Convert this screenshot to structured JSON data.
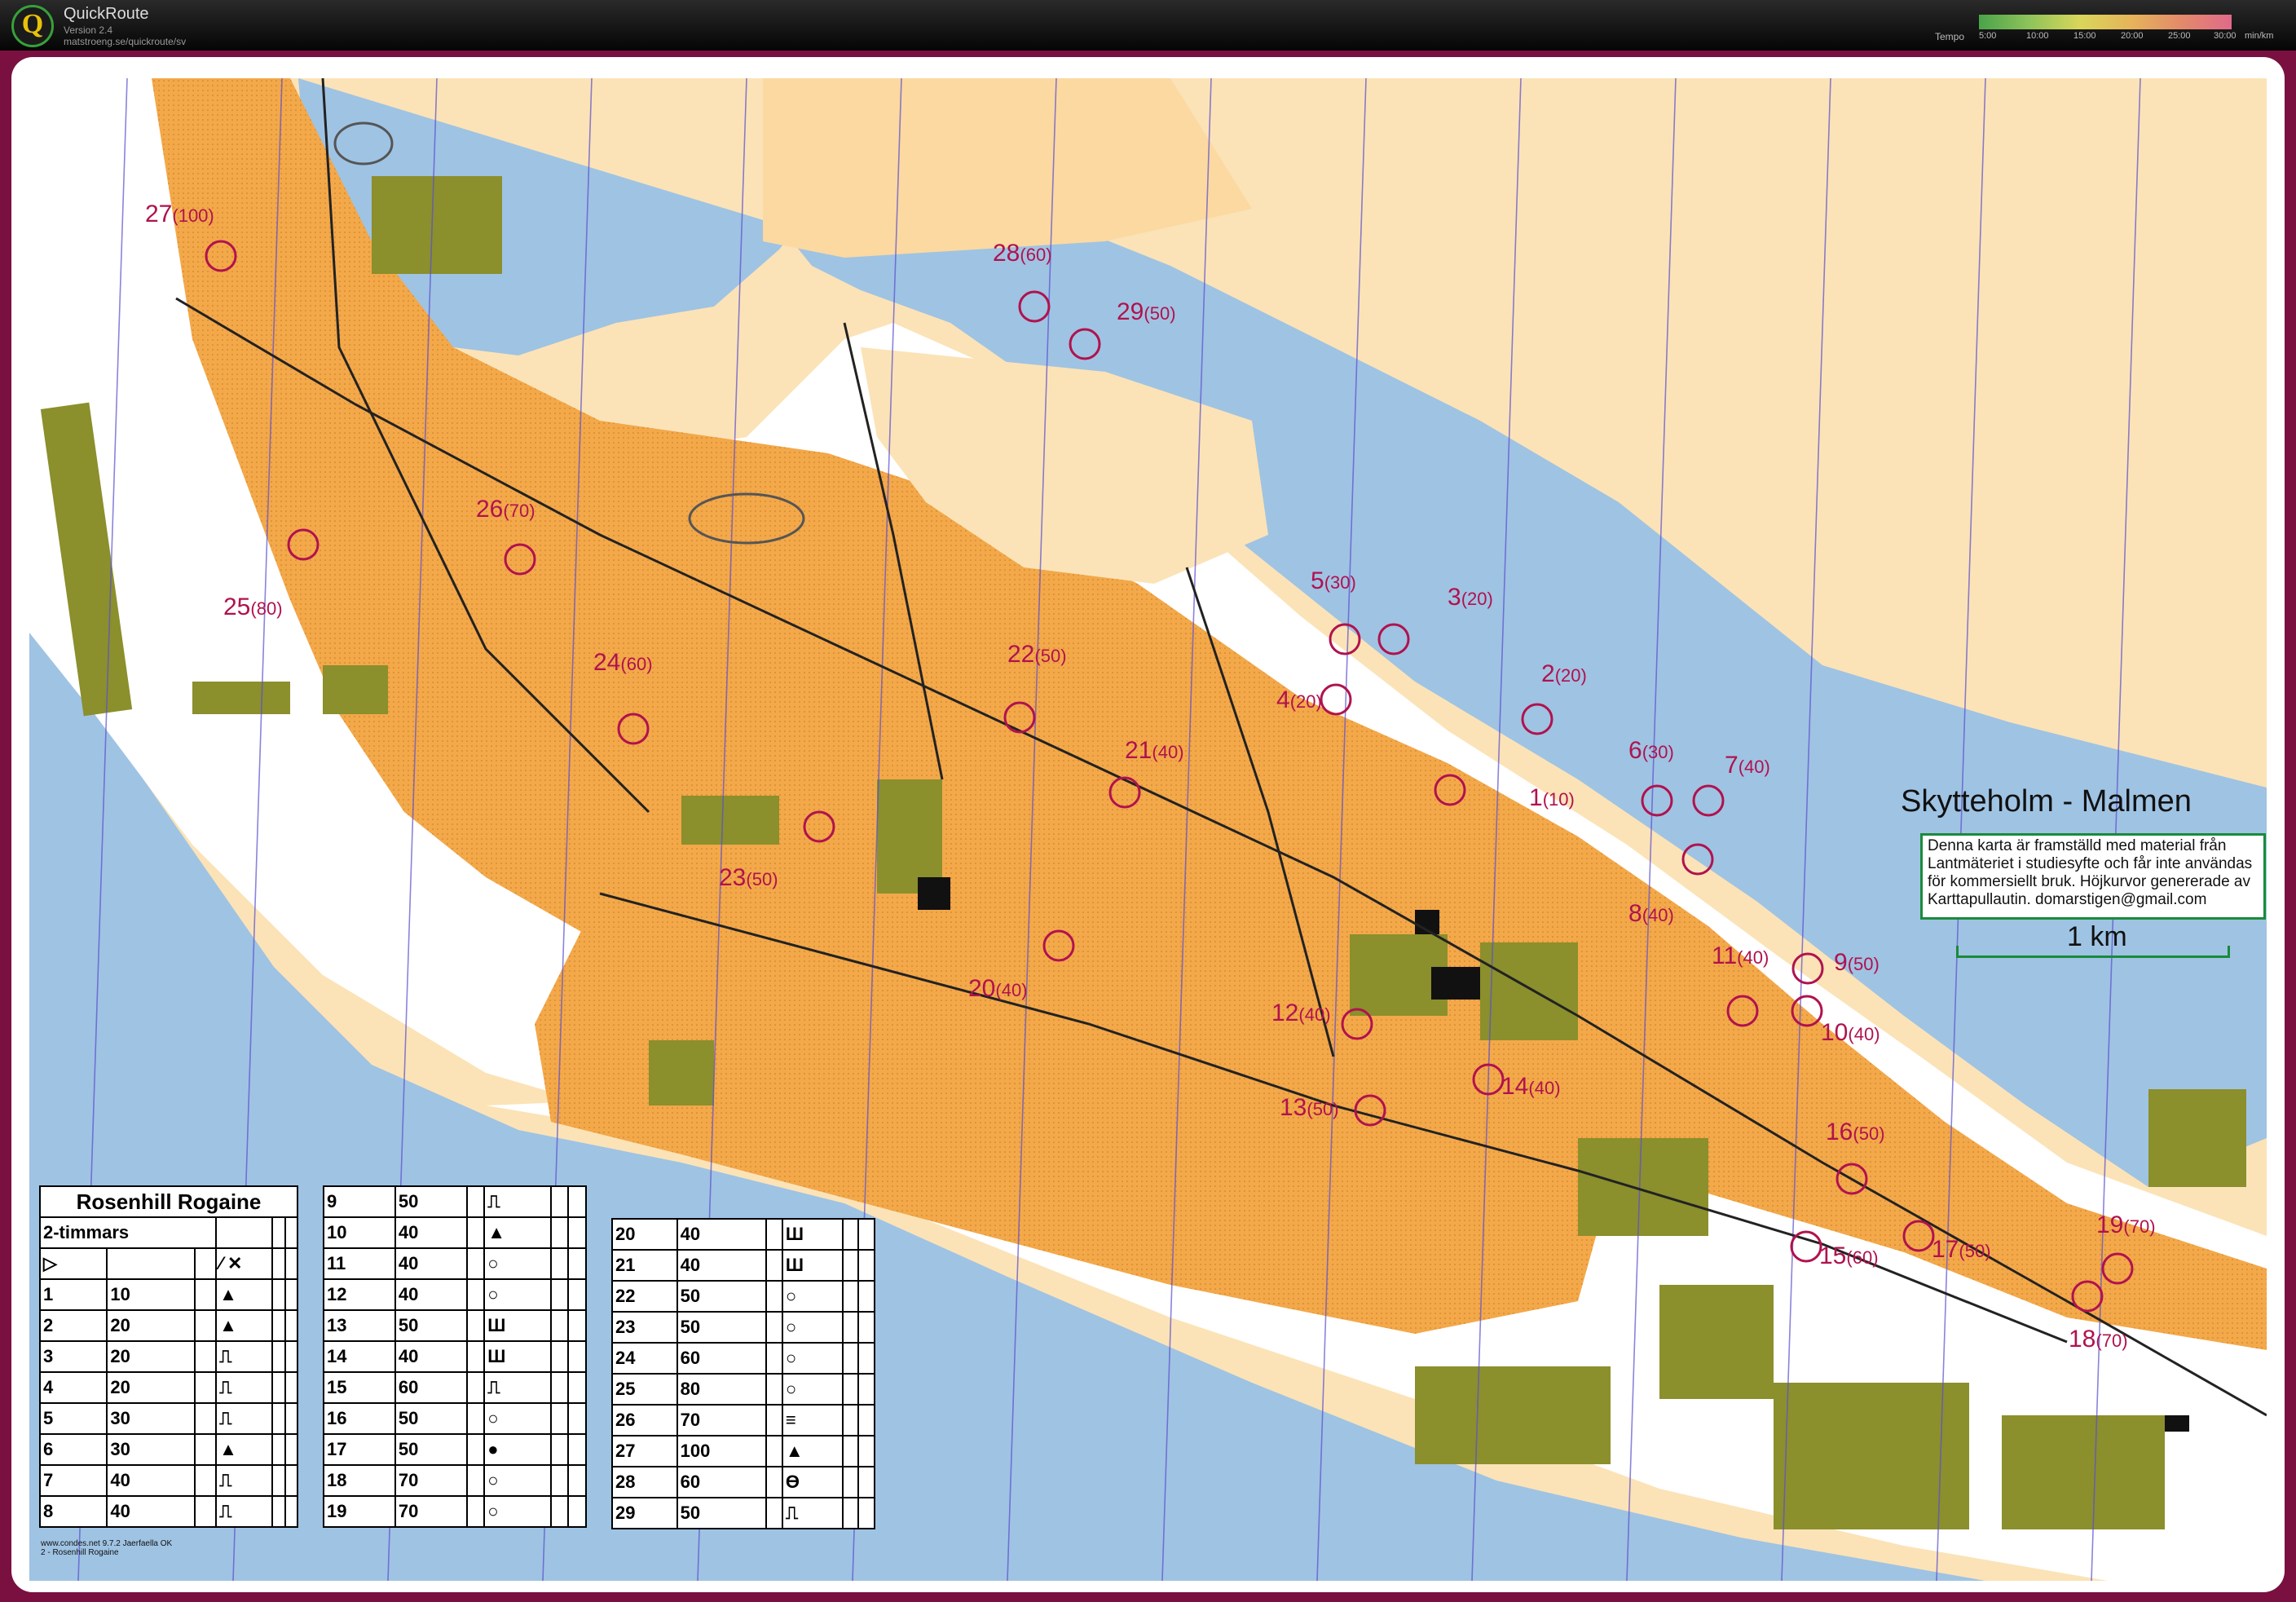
{
  "app": {
    "name": "QuickRoute",
    "version": "Version 2.4",
    "url": "matstroeng.se/quickroute/sv"
  },
  "tempo": {
    "label": "Tempo",
    "ticks": [
      "5:00",
      "10:00",
      "15:00",
      "20:00",
      "25:00",
      "30:00"
    ],
    "unit": "min/km"
  },
  "map": {
    "title": "Skytteholm - Malmen",
    "notice": "Denna karta är framställd med material från Lantmäteriet i studiesyfte och får inte användas för kommersiellt bruk. Höjkurvor genererade av Karttapullautin. domarstigen@gmail.com",
    "scale_label": "1 km",
    "footer_lines": [
      "www.condes.net 9.7.2 Jaerfaella OK",
      "2 - Rosenhill Rogaine"
    ],
    "colors": {
      "water": "#9fc3e3",
      "open": "#f3a84a",
      "rough_open": "#fbd9a1",
      "building": "#8b8f2c",
      "control": "#b0124e",
      "frame": "#7a1040"
    },
    "controls": [
      {
        "n": "1",
        "pts": "10"
      },
      {
        "n": "2",
        "pts": "20"
      },
      {
        "n": "3",
        "pts": "20"
      },
      {
        "n": "4",
        "pts": "20"
      },
      {
        "n": "5",
        "pts": "30"
      },
      {
        "n": "6",
        "pts": "30"
      },
      {
        "n": "7",
        "pts": "40"
      },
      {
        "n": "8",
        "pts": "40"
      },
      {
        "n": "9",
        "pts": "50"
      },
      {
        "n": "10",
        "pts": "40"
      },
      {
        "n": "11",
        "pts": "40"
      },
      {
        "n": "12",
        "pts": "40"
      },
      {
        "n": "13",
        "pts": "50"
      },
      {
        "n": "14",
        "pts": "40"
      },
      {
        "n": "15",
        "pts": "60"
      },
      {
        "n": "16",
        "pts": "50"
      },
      {
        "n": "17",
        "pts": "50"
      },
      {
        "n": "18",
        "pts": "70"
      },
      {
        "n": "19",
        "pts": "70"
      },
      {
        "n": "20",
        "pts": "40"
      },
      {
        "n": "21",
        "pts": "40"
      },
      {
        "n": "22",
        "pts": "50"
      },
      {
        "n": "23",
        "pts": "50"
      },
      {
        "n": "24",
        "pts": "60"
      },
      {
        "n": "25",
        "pts": "80"
      },
      {
        "n": "26",
        "pts": "70"
      },
      {
        "n": "27",
        "pts": "100"
      },
      {
        "n": "28",
        "pts": "60"
      },
      {
        "n": "29",
        "pts": "50"
      }
    ]
  },
  "description_sheet": {
    "title": "Rosenhill Rogaine",
    "subtitle": "2-timmars",
    "col1": [
      {
        "n": "1",
        "p": "10",
        "sym": "▲"
      },
      {
        "n": "2",
        "p": "20",
        "sym": "▲"
      },
      {
        "n": "3",
        "p": "20",
        "sym": "⎍"
      },
      {
        "n": "4",
        "p": "20",
        "sym": "⎍"
      },
      {
        "n": "5",
        "p": "30",
        "sym": "⎍"
      },
      {
        "n": "6",
        "p": "30",
        "sym": "▲"
      },
      {
        "n": "7",
        "p": "40",
        "sym": "⎍"
      },
      {
        "n": "8",
        "p": "40",
        "sym": "⎍"
      }
    ],
    "col2": [
      {
        "n": "9",
        "p": "50",
        "sym": "⎍"
      },
      {
        "n": "10",
        "p": "40",
        "sym": "▲"
      },
      {
        "n": "11",
        "p": "40",
        "sym": "○"
      },
      {
        "n": "12",
        "p": "40",
        "sym": "○"
      },
      {
        "n": "13",
        "p": "50",
        "sym": "Ш"
      },
      {
        "n": "14",
        "p": "40",
        "sym": "Ш"
      },
      {
        "n": "15",
        "p": "60",
        "sym": "⎍"
      },
      {
        "n": "16",
        "p": "50",
        "sym": "○"
      },
      {
        "n": "17",
        "p": "50",
        "sym": "●"
      },
      {
        "n": "18",
        "p": "70",
        "sym": "○"
      },
      {
        "n": "19",
        "p": "70",
        "sym": "○"
      }
    ],
    "col3": [
      {
        "n": "20",
        "p": "40",
        "sym": "Ш"
      },
      {
        "n": "21",
        "p": "40",
        "sym": "Ш"
      },
      {
        "n": "22",
        "p": "50",
        "sym": "○"
      },
      {
        "n": "23",
        "p": "50",
        "sym": "○"
      },
      {
        "n": "24",
        "p": "60",
        "sym": "○"
      },
      {
        "n": "25",
        "p": "80",
        "sym": "○"
      },
      {
        "n": "26",
        "p": "70",
        "sym": "≡"
      },
      {
        "n": "27",
        "p": "100",
        "sym": "▲"
      },
      {
        "n": "28",
        "p": "60",
        "sym": "ϴ"
      },
      {
        "n": "29",
        "p": "50",
        "sym": "⎍"
      }
    ]
  }
}
